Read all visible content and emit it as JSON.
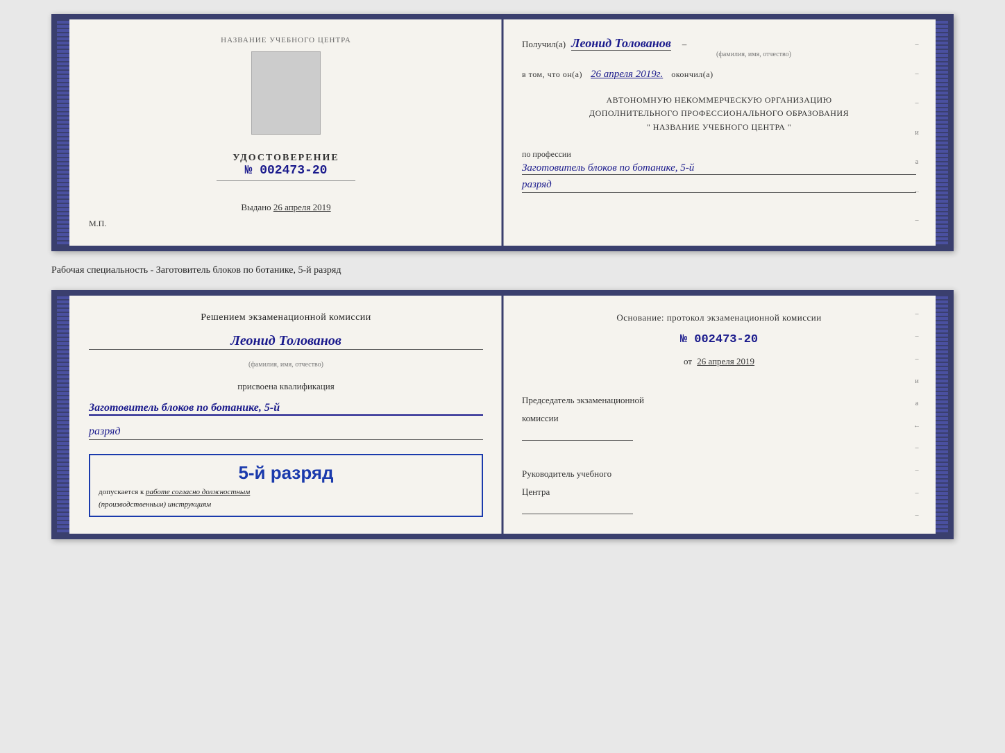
{
  "top_doc": {
    "left": {
      "center_label": "НАЗВАНИЕ УЧЕБНОГО ЦЕНТРА",
      "udostoverenie_title": "УДОСТОВЕРЕНИЕ",
      "number_prefix": "№",
      "number": "002473-20",
      "vydano_label": "Выдано",
      "vydano_date": "26 апреля 2019",
      "mp_label": "М.П."
    },
    "right": {
      "poluchil_label": "Получил(а)",
      "fio": "Леонид Толованов",
      "fio_sub": "(фамилия, имя, отчество)",
      "v_tom_label": "в том, что он(а)",
      "date_value": "26 апреля 2019г.",
      "okончил_label": "окончил(а)",
      "org_line1": "АВТОНОМНУЮ НЕКОММЕРЧЕСКУЮ ОРГАНИЗАЦИЮ",
      "org_line2": "ДОПОЛНИТЕЛЬНОГО ПРОФЕССИОНАЛЬНОГО ОБРАЗОВАНИЯ",
      "org_line3": "\"  НАЗВАНИЕ УЧЕБНОГО ЦЕНТРА  \"",
      "po_professii_label": "по профессии",
      "profession": "Заготовитель блоков по ботанике, 5-й",
      "razryad": "разряд"
    }
  },
  "annotation": {
    "text": "Рабочая специальность - Заготовитель блоков по ботанике, 5-й разряд"
  },
  "bottom_doc": {
    "left": {
      "resheniem_label": "Решением экзаменационной комиссии",
      "fio": "Леонид Толованов",
      "fio_sub": "(фамилия, имя, отчество)",
      "prisvoena_label": "присвоена квалификация",
      "qualification": "Заготовитель блоков по ботанике, 5-й",
      "razryad": "разряд",
      "stamp_rank": "5-й разряд",
      "dopuskaetsya_label": "допускается к",
      "dopuskaetsya_value": "работе согласно должностным",
      "instruktsiyam": "(производственным) инструкциям"
    },
    "right": {
      "osnovanie_label": "Основание: протокол экзаменационной комиссии",
      "number_prefix": "№",
      "number": "002473-20",
      "ot_label": "от",
      "ot_date": "26 апреля 2019",
      "predsedatel_label": "Председатель экзаменационной",
      "komissia_label": "комиссии",
      "rukovoditel_label": "Руководитель учебного",
      "centr_label": "Центра"
    }
  },
  "side_marks": {
    "letters": [
      "–",
      "–",
      "–",
      "и",
      "а",
      "←",
      "–",
      "–",
      "–",
      "–"
    ]
  }
}
